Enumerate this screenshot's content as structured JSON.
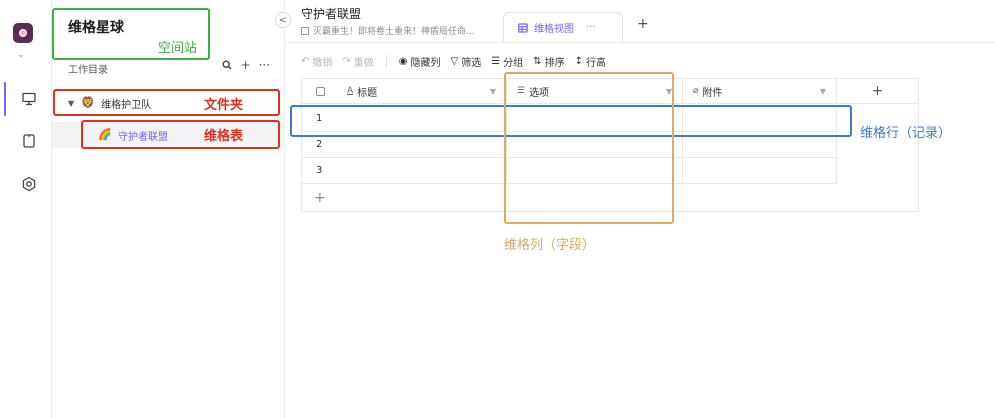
{
  "rail": {
    "icons": [
      "monitor-icon",
      "tablet-icon",
      "settings-hex-icon"
    ],
    "chevron": "⌄"
  },
  "sidebar": {
    "space_name": "维格星球",
    "catalog_label": "工作目录",
    "tools": {
      "search": "🔍",
      "add": "+",
      "more": "···"
    },
    "tree": {
      "folder": {
        "label": "维格护卫队",
        "emoji": "🦁"
      },
      "sheet": {
        "label": "守护者联盟",
        "emoji": "🌈"
      }
    }
  },
  "main": {
    "collapse_glyph": "<",
    "node_title": "守护者联盟",
    "node_desc": "灭霸重生！即将卷土重来！神盾局任命...",
    "view_tab": {
      "label": "维格视图",
      "more": "···"
    },
    "add_view": "+"
  },
  "toolbar": {
    "undo": "撤销",
    "redo": "重做",
    "hide_columns": "隐藏列",
    "filter": "筛选",
    "group": "分组",
    "sort": "排序",
    "row_height": "行高"
  },
  "grid": {
    "columns": [
      {
        "icon": "A",
        "label": "标题"
      },
      {
        "icon": "☰",
        "label": "选项"
      },
      {
        "icon": "⌀",
        "label": "附件"
      }
    ],
    "add_column": "+",
    "rows": [
      "1",
      "2",
      "3"
    ],
    "add_row": "+"
  },
  "annotations": {
    "space_station": "空间站",
    "folder": "文件夹",
    "sheet": "维格表",
    "row": "维格行（记录）",
    "column": "维格列（字段）"
  },
  "colors": {
    "accent": "#7b61ff",
    "annot_green": "#3cb043",
    "annot_red": "#e0301e",
    "annot_blue": "#3a7bd5",
    "annot_orange": "#e0a95b"
  }
}
